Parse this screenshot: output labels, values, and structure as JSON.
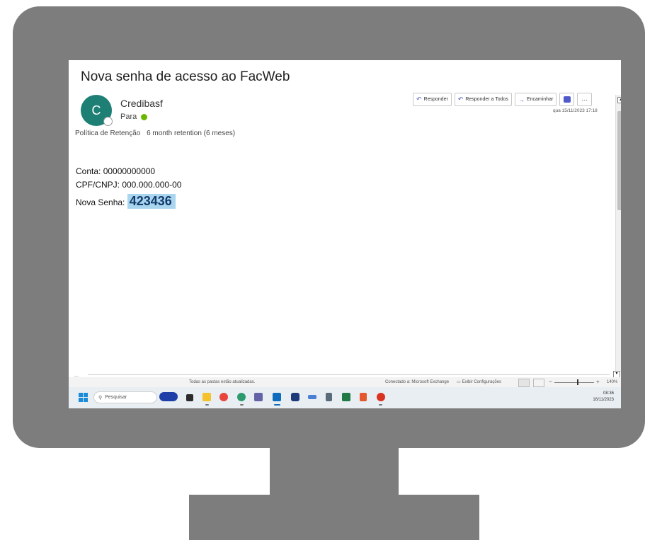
{
  "email": {
    "subject": "Nova senha de acesso ao FacWeb",
    "avatar_initial": "C",
    "sender": "Credibasf",
    "to_label": "Para",
    "retention_label": "Política de Retenção",
    "retention_value": "6 month retention (6 meses)",
    "date": "qua 15/11/2023 17:18",
    "body": {
      "conta": "Conta: 00000000000",
      "cpf": "CPF/CNPJ: 000.000.000-00",
      "senha_label": "Nova Senha:",
      "senha_value": "423436"
    }
  },
  "actions": {
    "reply": "Responder",
    "reply_all": "Responder a Todos",
    "forward": "Encaminhar",
    "more": "···"
  },
  "status_bar": {
    "left": "Todas as pastas estão atualizadas.",
    "connection": "Conectado a: Microsoft Exchange",
    "settings": "Exibir Configurações",
    "zoom": "140%"
  },
  "taskbar": {
    "search_placeholder": "Pesquisar",
    "time": "08:36",
    "date": "16/11/2023"
  },
  "colors": {
    "avatar": "#1e8075",
    "highlight": "#a9d6ee",
    "monitor": "#7d7d7d"
  }
}
